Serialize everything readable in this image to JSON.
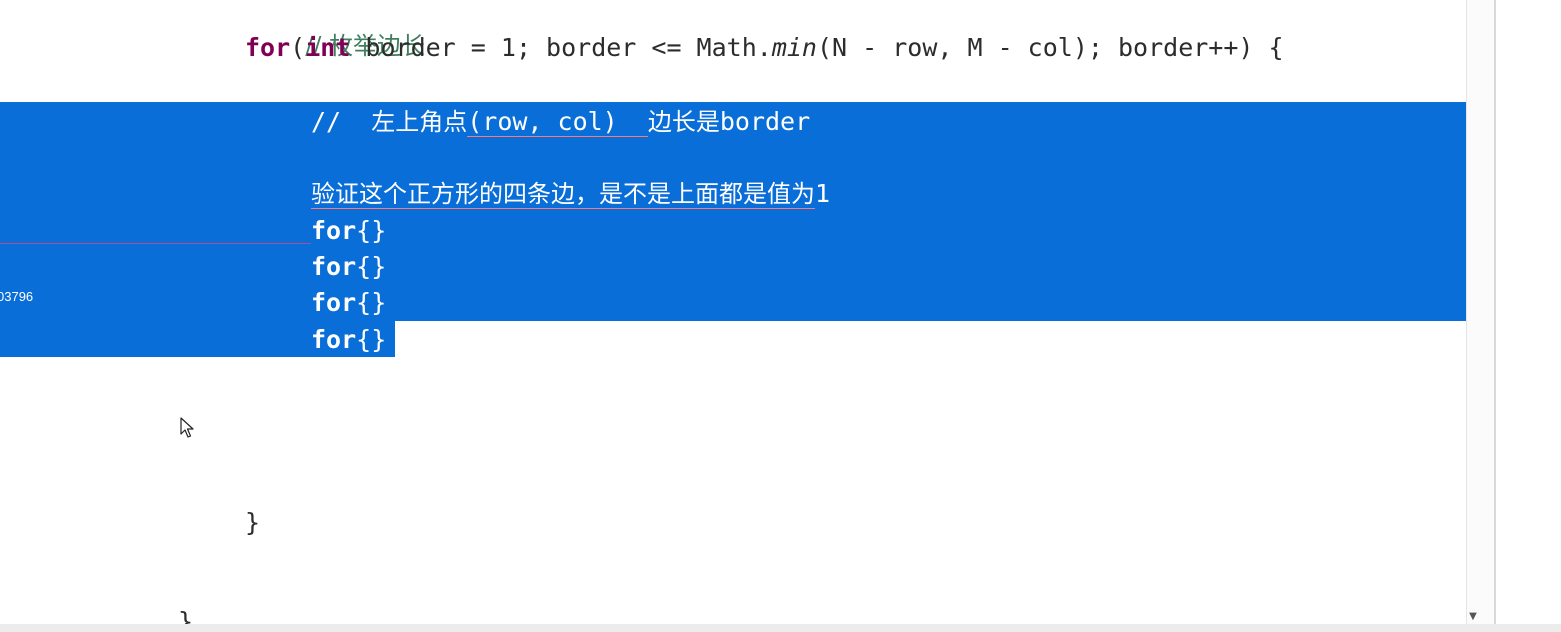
{
  "editor": {
    "lines": {
      "comment_enum": "// 枚举边长",
      "for_kw": "for",
      "for_open": "(",
      "int_kw": "int",
      "for_part1": " border = 1; border <= Math.",
      "min": "min",
      "for_part2": "(N - row, M - col); border++) {",
      "comment_corner_prefix": "//  ",
      "comment_corner_cjk1": "左上角点",
      "comment_corner_code": "(row, col)  ",
      "comment_corner_cjk2": "边长是",
      "comment_corner_end": "border",
      "verify_cjk": "验证这个正方形的四条边，是不是上面都是值为",
      "verify_one": "1",
      "inner_for_kw": "for",
      "inner_for_braces": "{}",
      "close_brace": "}",
      "partial_brace": "}"
    },
    "gutter_number": "03796"
  },
  "colors": {
    "selection": "#0a6ed8",
    "keyword": "#7f0055",
    "comment": "#3f7f5f",
    "text": "#2c2c2c"
  },
  "icons": {
    "cursor": "mouse-pointer-icon",
    "scroll_down": "chevron-down-icon"
  }
}
